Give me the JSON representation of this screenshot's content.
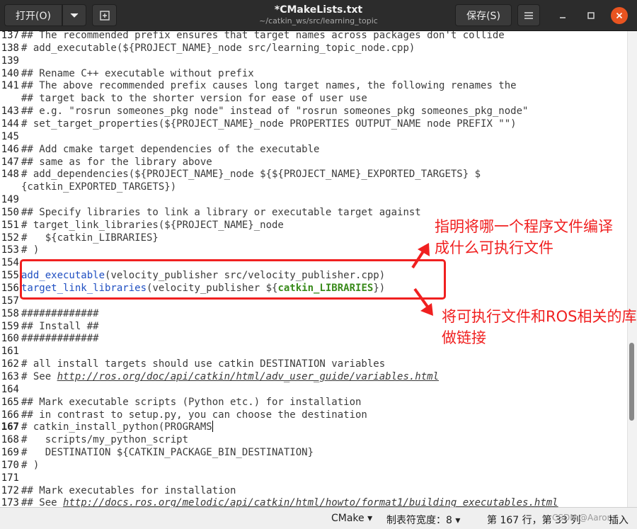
{
  "header": {
    "open_label": "打开(O)",
    "open_menu_icon": "chevron-down-icon",
    "new_icon": "new-document-icon",
    "title": "*CMakeLists.txt",
    "path": "~/catkin_ws/src/learning_topic",
    "save_label": "保存(S)",
    "menu_icon": "hamburger-icon",
    "minimize_icon": "minimize-icon",
    "maximize_icon": "maximize-icon",
    "close_icon": "close-icon",
    "close_color": "#e95420"
  },
  "editor": {
    "lines": [
      {
        "n": "137",
        "text": "## The recommended prefix ensures that target names across packages don't collide"
      },
      {
        "n": "138",
        "text": "# add_executable(${PROJECT_NAME}_node src/learning_topic_node.cpp)"
      },
      {
        "n": "139",
        "text": ""
      },
      {
        "n": "140",
        "text": "## Rename C++ executable without prefix"
      },
      {
        "n": "141",
        "text": "## The above recommended prefix causes long target names, the following renames the"
      },
      {
        "n": "",
        "text": "## target back to the shorter version for ease of user use"
      },
      {
        "n": "143",
        "text": "## e.g. \"rosrun someones_pkg node\" instead of \"rosrun someones_pkg someones_pkg_node\""
      },
      {
        "n": "144",
        "text": "# set_target_properties(${PROJECT_NAME}_node PROPERTIES OUTPUT_NAME node PREFIX \"\")"
      },
      {
        "n": "145",
        "text": ""
      },
      {
        "n": "146",
        "text": "## Add cmake target dependencies of the executable"
      },
      {
        "n": "147",
        "text": "## same as for the library above"
      },
      {
        "n": "148",
        "text": "# add_dependencies(${PROJECT_NAME}_node ${${PROJECT_NAME}_EXPORTED_TARGETS} $"
      },
      {
        "n": "",
        "text": "{catkin_EXPORTED_TARGETS})"
      },
      {
        "n": "149",
        "text": ""
      },
      {
        "n": "150",
        "text": "## Specify libraries to link a library or executable target against"
      },
      {
        "n": "151",
        "text": "# target_link_libraries(${PROJECT_NAME}_node"
      },
      {
        "n": "152",
        "text": "#   ${catkin_LIBRARIES}"
      },
      {
        "n": "153",
        "text": "# )"
      },
      {
        "n": "154",
        "text": ""
      },
      {
        "n": "155",
        "text": ""
      },
      {
        "n": "156",
        "text": ""
      },
      {
        "n": "157",
        "text": ""
      },
      {
        "n": "158",
        "text": "#############"
      },
      {
        "n": "159",
        "text": "## Install ##"
      },
      {
        "n": "160",
        "text": "#############"
      },
      {
        "n": "161",
        "text": ""
      },
      {
        "n": "162",
        "text": "# all install targets should use catkin DESTINATION variables"
      },
      {
        "n": "163",
        "text": ""
      },
      {
        "n": "164",
        "text": ""
      },
      {
        "n": "165",
        "text": "## Mark executable scripts (Python etc.) for installation"
      },
      {
        "n": "166",
        "text": "## in contrast to setup.py, you can choose the destination"
      },
      {
        "n": "167",
        "text": "# catkin_install_python(PROGRAMS"
      },
      {
        "n": "168",
        "text": "#   scripts/my_python_script"
      },
      {
        "n": "169",
        "text": "#   DESTINATION ${CATKIN_PACKAGE_BIN_DESTINATION}"
      },
      {
        "n": "170",
        "text": "# )"
      },
      {
        "n": "171",
        "text": ""
      },
      {
        "n": "172",
        "text": "## Mark executables for installation"
      },
      {
        "n": "173",
        "text": ""
      }
    ],
    "line155_cmd": "add_executable",
    "line155_rest": "(velocity_publisher src/velocity_publisher.cpp)",
    "line156_cmd": "target_link_libraries",
    "line156_mid": "(velocity_publisher ${",
    "line156_var": "catkin_LIBRARIES",
    "line156_end": "})",
    "line163_prefix": "# See ",
    "line163_url": "http://ros.org/doc/api/catkin/html/adv_user_guide/variables.html",
    "line173_prefix": "## See ",
    "line173_url": "http://docs.ros.org/melodic/api/catkin/html/howto/format1/building_executables.html"
  },
  "annotations": {
    "note1": "指明将哪一个程序文件编译成什么可执行文件",
    "note2": "将可执行文件和ROS相关的库做链接",
    "color": "#f02020"
  },
  "status": {
    "language": "CMake ▾",
    "tab_width": "制表符宽度：8 ▾",
    "position": "第 167 行，第 33 列",
    "insert_mode": "插入",
    "watermark": "CSDN @Aaron",
    "watermark_tail": "插入"
  }
}
